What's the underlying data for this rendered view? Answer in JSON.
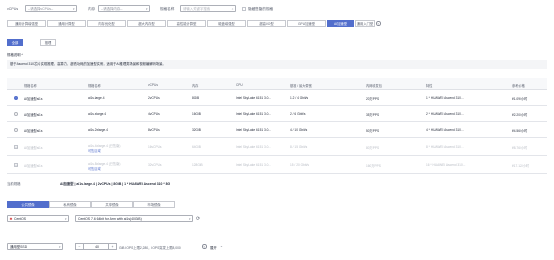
{
  "filters": {
    "vcpu_label": "vCPUs",
    "vcpu_placeholder": "--请选择vCPUs--",
    "memory_label": "内存",
    "memory_placeholder": "--请选择内存--",
    "spec_label": "规格名称",
    "spec_placeholder": "请输入关键字搜索",
    "hide_soldout_label": "隐藏售罄的规格"
  },
  "category_tabs": [
    "通用计算增强型",
    "通用计算型",
    "内存优化型",
    "超大内存型",
    "高性能计算型",
    "磁盘增强型",
    "超高I/O型",
    "GPU加速型",
    "AI加速型",
    "通用入门型"
  ],
  "active_tab": "AI加速型",
  "arch": {
    "options": [
      "全部",
      "推理"
    ],
    "active": "全部"
  },
  "notice": {
    "title": "规格说明 ^",
    "text": "基于Ascend 310芯片实现推理、高算力、超低功耗的加速型实例，适用于AI推理类场景和视频编解码场景。"
  },
  "table": {
    "headers": [
      "规格名称",
      "规格名称",
      "vCPUs",
      "内存",
      "CPU",
      "基准 / 最大带宽",
      "内网收发包",
      "特性",
      "参考价格"
    ],
    "rows": [
      {
        "selected": true,
        "disabled": false,
        "name": "AI加速型ai1s",
        "spec": "ai1s.large.4",
        "note": "",
        "vcpu": "2vCPUs",
        "mem": "8GiB",
        "cpu": "Intel SkyLake 6151 3.0...",
        "bw": "1.2 / 4 Gbit/s",
        "pps": "20万PPS",
        "feature": "1 * HUAWEI Ascend 310...",
        "price": "¥1.09/小时"
      },
      {
        "selected": false,
        "disabled": false,
        "name": "AI加速型ai1s",
        "spec": "ai1s.xlarge.4",
        "note": "",
        "vcpu": "4vCPUs",
        "mem": "16GiB",
        "cpu": "Intel SkyLake 6151 3.0...",
        "bw": "2 / 6 Gbit/s",
        "pps": "35万PPS",
        "feature": "2 * HUAWEI Ascend 310...",
        "price": "¥2.20/小时"
      },
      {
        "selected": false,
        "disabled": false,
        "name": "AI加速型ai1s",
        "spec": "ai1s.2xlarge.4",
        "note": "",
        "vcpu": "8vCPUs",
        "mem": "32GiB",
        "cpu": "Intel SkyLake 6151 3.0...",
        "bw": "4 / 10 Gbit/s",
        "pps": "50万PPS",
        "feature": "4 * HUAWEI Ascend 310...",
        "price": "¥4.56/小时"
      },
      {
        "selected": false,
        "disabled": true,
        "name": "AI加速型ai1s",
        "spec": "ai1s.4xlarge.4 (已售罄)",
        "note": "可售区域",
        "vcpu": "16vCPUs",
        "mem": "64GiB",
        "cpu": "Intel SkyLake 6151 3.0...",
        "bw": "8 / 15 Gbit/s",
        "pps": "80万PPS",
        "feature": "8 * HUAWEI Ascend 310...",
        "price": "¥8.76/小时"
      },
      {
        "selected": false,
        "disabled": true,
        "name": "AI加速型ai1s",
        "spec": "ai1s.8xlarge.4 (已售罄)",
        "note": "可售区域",
        "vcpu": "32vCPUs",
        "mem": "128GiB",
        "cpu": "Intel SkyLake 6151 3.0...",
        "bw": "15 / 20 Gbit/s",
        "pps": "160万PPS",
        "feature": "16 * HUAWEI Ascend 310...",
        "price": "¥17.12/小时"
      }
    ]
  },
  "current_spec": {
    "label": "当前规格",
    "value": "AI加速型 | ai1s.large.4 | 2vCPUs | 8GiB | 1 * HUAWEI Ascend 310 * 8G"
  },
  "image_tabs": [
    "公共镜像",
    "私有镜像",
    "共享镜像",
    "市场镜像"
  ],
  "active_image_tab": "公共镜像",
  "os": {
    "value": "CentOS",
    "version": "CentOS 7.6 64bit for Arm with ai1s(40GiB)"
  },
  "disk": {
    "type": "通用型SSD",
    "size": "40",
    "unit": "GiB",
    "info": "GiB IOPS上限2,280，IOPS突发上限8,000",
    "add_label": "展开"
  }
}
